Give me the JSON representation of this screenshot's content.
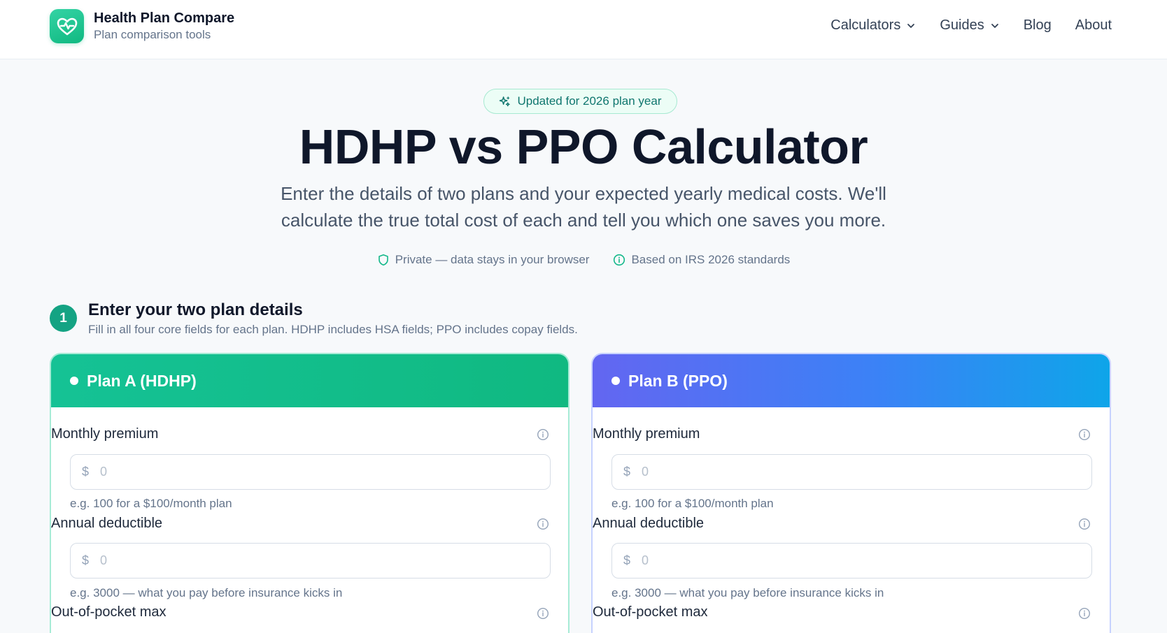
{
  "brand": {
    "title": "Health Plan Compare",
    "subtitle": "Plan comparison tools",
    "logo_icon": "heart-pulse-icon"
  },
  "nav": {
    "items": [
      {
        "label": "Calculators",
        "has_dropdown": true
      },
      {
        "label": "Guides",
        "has_dropdown": true
      },
      {
        "label": "Blog",
        "has_dropdown": false
      },
      {
        "label": "About",
        "has_dropdown": false
      }
    ]
  },
  "hero": {
    "badge": "Updated for 2026 plan year",
    "title": "HDHP vs PPO Calculator",
    "description": "Enter the details of two plans and your expected yearly medical costs. We'll calculate the true total cost of each and tell you which one saves you more.",
    "trust": [
      {
        "icon": "shield-icon",
        "text": "Private — data stays in your browser"
      },
      {
        "icon": "info-circle-icon",
        "text": "Based on IRS 2026 standards"
      }
    ]
  },
  "step": {
    "number": "1",
    "title": "Enter your two plan details",
    "subtitle": "Fill in all four core fields for each plan. HDHP includes HSA fields; PPO includes copay fields."
  },
  "plans": [
    {
      "title": "Plan A (HDHP)",
      "fields": [
        {
          "label": "Monthly premium",
          "currency": "$",
          "value": "",
          "placeholder": "0",
          "help": "e.g. 100 for a $100/month plan"
        },
        {
          "label": "Annual deductible",
          "currency": "$",
          "value": "",
          "placeholder": "0",
          "help": "e.g. 3000 — what you pay before insurance kicks in"
        },
        {
          "label": "Out-of-pocket max"
        }
      ]
    },
    {
      "title": "Plan B (PPO)",
      "fields": [
        {
          "label": "Monthly premium",
          "currency": "$",
          "value": "",
          "placeholder": "0",
          "help": "e.g. 100 for a $100/month plan"
        },
        {
          "label": "Annual deductible",
          "currency": "$",
          "value": "",
          "placeholder": "0",
          "help": "e.g. 3000 — what you pay before insurance kicks in"
        },
        {
          "label": "Out-of-pocket max"
        }
      ]
    }
  ],
  "colors": {
    "accent_green": "#10b981",
    "accent_indigo": "#6366f1",
    "accent_sky": "#0ea5e9",
    "text_primary": "#0f172a",
    "text_muted": "#64748b"
  }
}
